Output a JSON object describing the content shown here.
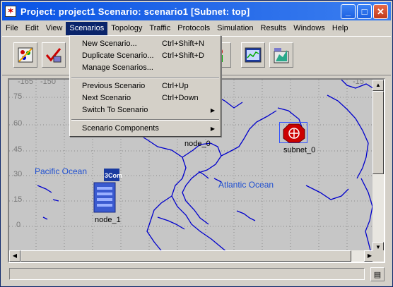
{
  "window": {
    "title": "Project: project1 Scenario: scenario1  [Subnet: top]",
    "title_icon": "app-star-icon",
    "controls": {
      "minimize": "_",
      "maximize": "□",
      "close": "✕"
    }
  },
  "menubar": {
    "items": [
      {
        "label": "File"
      },
      {
        "label": "Edit"
      },
      {
        "label": "View"
      },
      {
        "label": "Scenarios"
      },
      {
        "label": "Topology"
      },
      {
        "label": "Traffic"
      },
      {
        "label": "Protocols"
      },
      {
        "label": "Simulation"
      },
      {
        "label": "Results"
      },
      {
        "label": "Windows"
      },
      {
        "label": "Help"
      }
    ],
    "active": "Scenarios"
  },
  "toolbar": {
    "tools": [
      {
        "icon": "object-palette-icon"
      },
      {
        "icon": "verify-links-icon"
      },
      {
        "icon": "configure-simulation-icon"
      },
      {
        "icon": "view-results-icon"
      },
      {
        "icon": "analysis-panel-icon"
      }
    ]
  },
  "scenarios_menu": {
    "items": [
      {
        "label": "New Scenario...",
        "shortcut": "Ctrl+Shift+N"
      },
      {
        "label": "Duplicate Scenario...",
        "shortcut": "Ctrl+Shift+D"
      },
      {
        "label": "Manage Scenarios...",
        "shortcut": ""
      },
      {
        "label": "Previous Scenario",
        "shortcut": "Ctrl+Up"
      },
      {
        "label": "Next Scenario",
        "shortcut": "Ctrl+Down"
      },
      {
        "label": "Switch To Scenario",
        "shortcut": "",
        "submenu": true
      },
      {
        "label": "Scenario Components",
        "shortcut": "",
        "submenu": true
      }
    ]
  },
  "map": {
    "grid_labels": {
      "lat": [
        "75",
        "60",
        "45",
        "30",
        "15",
        "0"
      ],
      "top_lon": [
        "-165",
        "-150"
      ],
      "right_lon": [
        "-15"
      ]
    },
    "oceans": [
      "Pacific Ocean",
      "Atlantic Ocean"
    ],
    "nodes": [
      {
        "name": "node_0",
        "icon": "router-icon"
      },
      {
        "name": "node_1",
        "icon": "server-3com-icon",
        "badge": "3Com"
      },
      {
        "name": "subnet_0",
        "icon": "subnet-icon"
      }
    ],
    "colors": {
      "land_outline": "#0000cc",
      "background": "#c6c6c6",
      "subnet": "#cc0000"
    }
  }
}
